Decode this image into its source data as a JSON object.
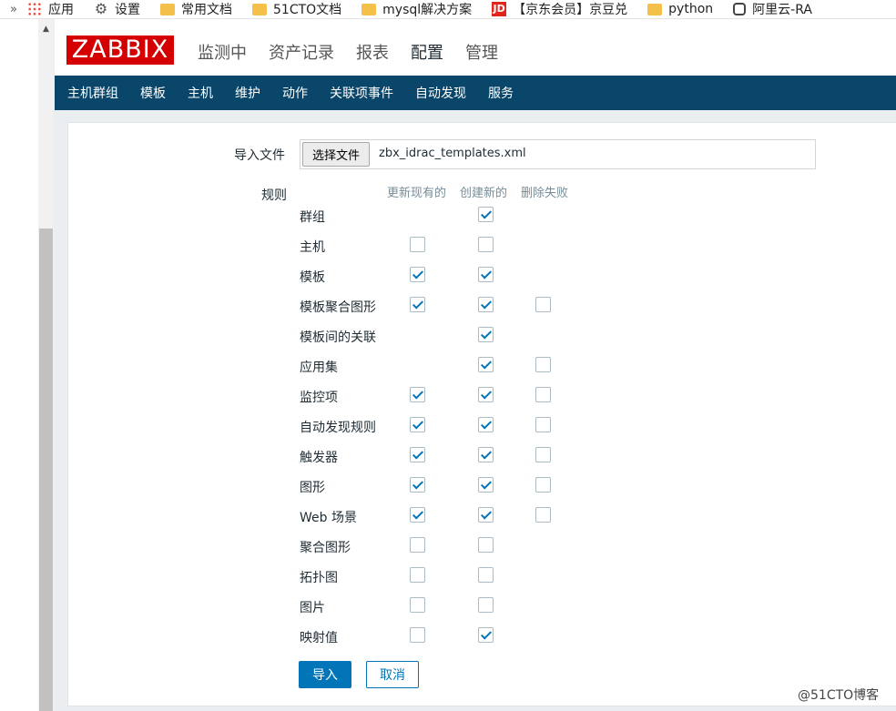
{
  "bookmarks": {
    "more": "»",
    "items": [
      {
        "label": "应用",
        "icon": "apps-icon"
      },
      {
        "label": "设置",
        "icon": "gear-icon"
      },
      {
        "label": "常用文档",
        "icon": "folder-icon"
      },
      {
        "label": "51CTO文档",
        "icon": "folder-icon"
      },
      {
        "label": "mysql解决方案",
        "icon": "folder-icon"
      },
      {
        "label": "【京东会员】京豆兑",
        "icon": "jd-icon",
        "icon_text": "JD"
      },
      {
        "label": "python",
        "icon": "folder-icon"
      },
      {
        "label": "阿里云-RA",
        "icon": "link-icon"
      }
    ]
  },
  "logo": "ZABBIX",
  "main_menu": [
    "监测中",
    "资产记录",
    "报表",
    "配置",
    "管理"
  ],
  "main_menu_selected": "配置",
  "sub_nav": [
    "主机群组",
    "模板",
    "主机",
    "维护",
    "动作",
    "关联项事件",
    "自动发现",
    "服务"
  ],
  "form": {
    "import_file_label": "导入文件",
    "choose_file_button": "选择文件",
    "file_name": "zbx_idrac_templates.xml",
    "rules_label": "规则",
    "col_update": "更新现有的",
    "col_create": "创建新的",
    "col_delete": "删除失败",
    "rules": [
      {
        "label": "群组",
        "update": null,
        "create": true,
        "delete": null
      },
      {
        "label": "主机",
        "update": false,
        "create": false,
        "delete": null
      },
      {
        "label": "模板",
        "update": true,
        "create": true,
        "delete": null
      },
      {
        "label": "模板聚合图形",
        "update": true,
        "create": true,
        "delete": false
      },
      {
        "label": "模板间的关联",
        "update": null,
        "create": true,
        "delete": null
      },
      {
        "label": "应用集",
        "update": null,
        "create": true,
        "delete": false
      },
      {
        "label": "监控项",
        "update": true,
        "create": true,
        "delete": false
      },
      {
        "label": "自动发现规则",
        "update": true,
        "create": true,
        "delete": false
      },
      {
        "label": "触发器",
        "update": true,
        "create": true,
        "delete": false
      },
      {
        "label": "图形",
        "update": true,
        "create": true,
        "delete": false
      },
      {
        "label": "Web 场景",
        "update": true,
        "create": true,
        "delete": false
      },
      {
        "label": "聚合图形",
        "update": false,
        "create": false,
        "delete": null
      },
      {
        "label": "拓扑图",
        "update": false,
        "create": false,
        "delete": null
      },
      {
        "label": "图片",
        "update": false,
        "create": false,
        "delete": null
      },
      {
        "label": "映射值",
        "update": false,
        "create": true,
        "delete": null
      }
    ],
    "import_button": "导入",
    "cancel_button": "取消"
  },
  "watermark": "@51CTO博客",
  "colors": {
    "brand": "#d40000",
    "nav": "#0a466a",
    "accent": "#0275b8"
  }
}
